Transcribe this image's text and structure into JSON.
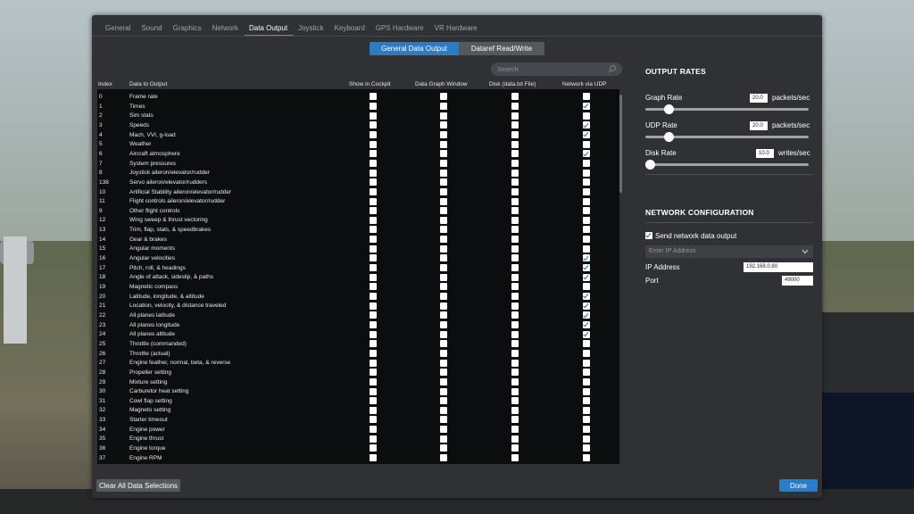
{
  "tabs": [
    "General",
    "Sound",
    "Graphics",
    "Network",
    "Data Output",
    "Joystick",
    "Keyboard",
    "GPS Hardware",
    "VR Hardware"
  ],
  "active_tab": "Data Output",
  "segments": [
    "General Data Output",
    "Dataref Read/Write"
  ],
  "search": {
    "placeholder": "Search",
    "icon": "search-icon"
  },
  "table": {
    "headers": [
      "Index",
      "Data to Output",
      "Show in Cockpit",
      "Data Graph Window",
      "Disk (data.txt File)",
      "Network via UDP"
    ],
    "rows": [
      {
        "index": "0",
        "name": "Frame rate",
        "udp": false
      },
      {
        "index": "1",
        "name": "Times",
        "udp": true
      },
      {
        "index": "2",
        "name": "Sim stats",
        "udp": false
      },
      {
        "index": "3",
        "name": "Speeds",
        "udp": true
      },
      {
        "index": "4",
        "name": "Mach, VVI, g-load",
        "udp": true
      },
      {
        "index": "5",
        "name": "Weather",
        "udp": false
      },
      {
        "index": "6",
        "name": "Aircraft atmosphere",
        "udp": true
      },
      {
        "index": "7",
        "name": "System pressures",
        "udp": false
      },
      {
        "index": "8",
        "name": "Joystick aileron/elevator/rudder",
        "udp": false
      },
      {
        "index": "138",
        "name": "Servo aileron/elevator/rudders",
        "udp": false
      },
      {
        "index": "10",
        "name": "Artificial Stability aileron/elevator/rudder",
        "udp": false
      },
      {
        "index": "11",
        "name": "Flight controls aileron/elevator/rudder",
        "udp": false
      },
      {
        "index": "9",
        "name": "Other flight controls",
        "udp": false
      },
      {
        "index": "12",
        "name": "Wing sweep & thrust vectoring",
        "udp": false
      },
      {
        "index": "13",
        "name": "Trim, flap, stats, & speedbrakes",
        "udp": false
      },
      {
        "index": "14",
        "name": "Gear & brakes",
        "udp": false
      },
      {
        "index": "15",
        "name": "Angular moments",
        "udp": false
      },
      {
        "index": "16",
        "name": "Angular velocities",
        "udp": true
      },
      {
        "index": "17",
        "name": "Pitch, roll, & headings",
        "udp": true
      },
      {
        "index": "18",
        "name": "Angle of attack, sideslip, & paths",
        "udp": true
      },
      {
        "index": "19",
        "name": "Magnetic compass",
        "udp": false
      },
      {
        "index": "20",
        "name": "Latitude, longitude, & altitude",
        "udp": true
      },
      {
        "index": "21",
        "name": "Location, velocity, & distance traveled",
        "udp": true
      },
      {
        "index": "22",
        "name": "All planes latitude",
        "udp": true
      },
      {
        "index": "23",
        "name": "All planes longitude",
        "udp": true
      },
      {
        "index": "24",
        "name": "All planes altitude",
        "udp": true
      },
      {
        "index": "25",
        "name": "Throttle (commanded)",
        "udp": false
      },
      {
        "index": "26",
        "name": "Throttle (actual)",
        "udp": false
      },
      {
        "index": "27",
        "name": "Engine feather, normal, beta, & reverse",
        "udp": false
      },
      {
        "index": "28",
        "name": "Propeller setting",
        "udp": false
      },
      {
        "index": "29",
        "name": "Mixture setting",
        "udp": false
      },
      {
        "index": "30",
        "name": "Carburetor heat setting",
        "udp": false
      },
      {
        "index": "31",
        "name": "Cowl flap setting",
        "udp": false
      },
      {
        "index": "32",
        "name": "Magneto setting",
        "udp": false
      },
      {
        "index": "33",
        "name": "Starter timeout",
        "udp": false
      },
      {
        "index": "34",
        "name": "Engine power",
        "udp": false
      },
      {
        "index": "35",
        "name": "Engine thrust",
        "udp": false
      },
      {
        "index": "36",
        "name": "Engine torque",
        "udp": false
      },
      {
        "index": "37",
        "name": "Engine RPM",
        "udp": false
      }
    ]
  },
  "output_rates": {
    "title": "OUTPUT RATES",
    "graph": {
      "label": "Graph Rate",
      "value": "20.0",
      "unit": "packets/sec",
      "level": 0.14
    },
    "udp": {
      "label": "UDP Rate",
      "value": "20.0",
      "unit": "packets/sec",
      "level": 0.14
    },
    "disk": {
      "label": "Disk Rate",
      "value": "10.0",
      "unit": "writes/sec",
      "level": 0.03
    }
  },
  "network": {
    "title": "NETWORK CONFIGURATION",
    "send_label": "Send network data output",
    "send_checked": true,
    "ip_placeholder": "Enter IP Address",
    "ip_label": "IP Address",
    "ip_value": "192.168.0.80",
    "port_label": "Port",
    "port_value": "49000"
  },
  "buttons": {
    "clear": "Clear All Data Selections",
    "done": "Done"
  },
  "colors": {
    "accent": "#2a7cc7",
    "dialog": "#2f3134",
    "table_bg": "#0c0d0e"
  }
}
